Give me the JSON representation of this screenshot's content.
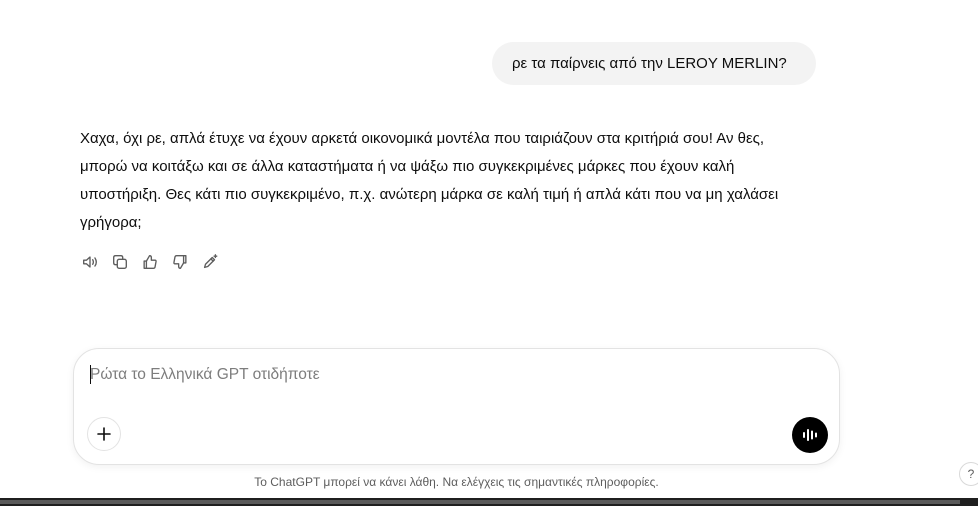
{
  "conversation": {
    "user_message": "ρε τα παίρνεις από την LEROY MERLIN?",
    "assistant_message": "Χαχα, όχι ρε, απλά έτυχε να έχουν αρκετά οικονομικά μοντέλα που ταιριάζουν στα κριτήριά σου! Αν θες, μπορώ να κοιτάξω και σε άλλα καταστήματα ή να ψάξω πιο συγκεκριμένες μάρκες που έχουν καλή υποστήριξη. Θες κάτι πιο συγκεκριμένο, π.χ. ανώτερη μάρκα σε καλή τιμή ή απλά κάτι που να μη χαλάσει γρήγορα;"
  },
  "message_actions": [
    {
      "icon": "speaker-icon"
    },
    {
      "icon": "copy-icon"
    },
    {
      "icon": "thumbs-up-icon"
    },
    {
      "icon": "thumbs-down-icon"
    },
    {
      "icon": "edit-pencil-sparkle-icon"
    }
  ],
  "composer": {
    "placeholder": "Ρώτα το Ελληνικά GPT οτιδήποτε",
    "value": ""
  },
  "footer": {
    "disclaimer": "Το ChatGPT μπορεί να κάνει λάθη. Να ελέγχεις τις σημαντικές πληροφορίες.",
    "help_label": "?"
  },
  "colors": {
    "user_bubble_bg": "#f3f3f3",
    "voice_button_bg": "#000000",
    "text": "#0d0d0d"
  }
}
